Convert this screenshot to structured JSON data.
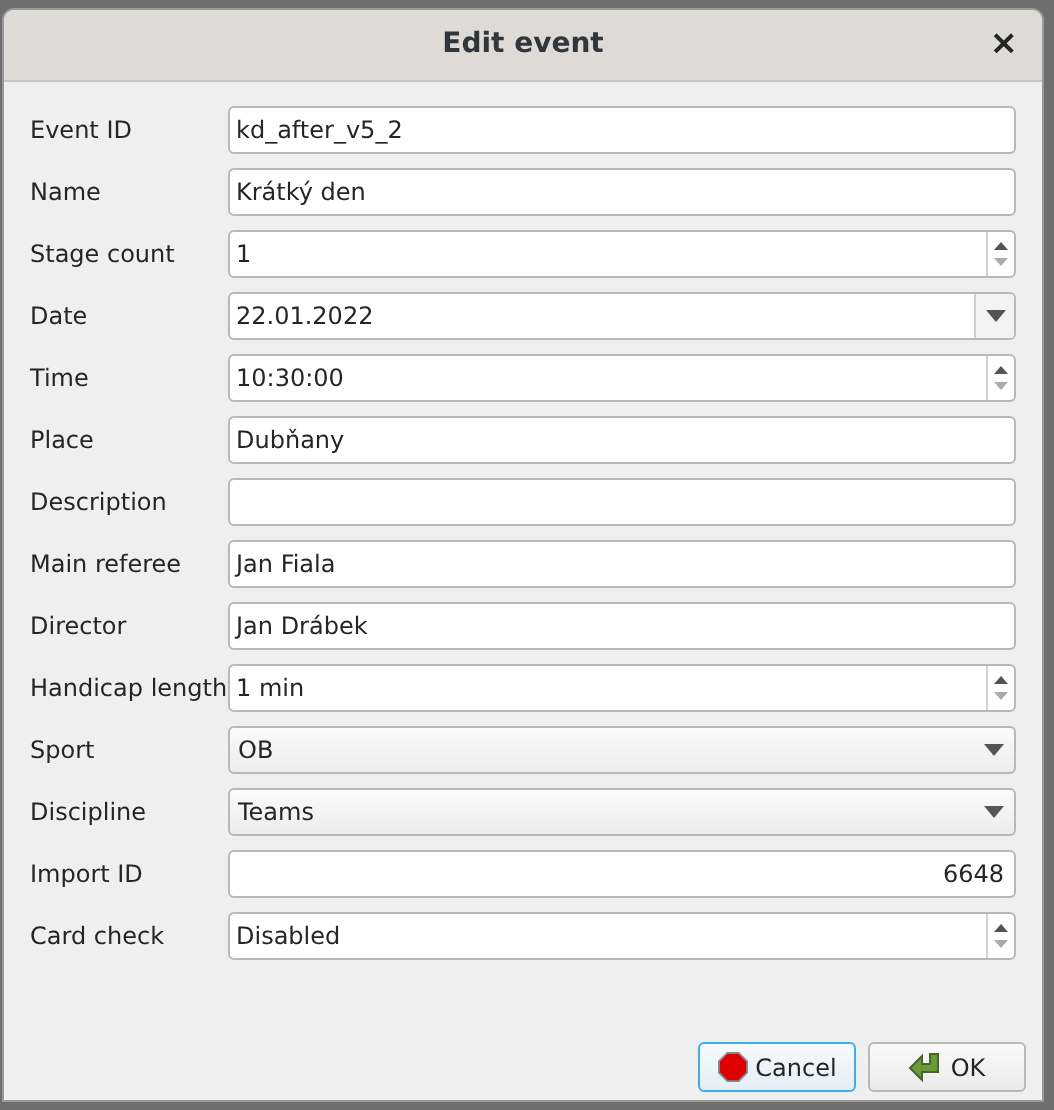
{
  "window": {
    "title": "Edit event",
    "close": "×"
  },
  "fields": [
    {
      "label": "Event ID",
      "kind": "text",
      "value": "kd_after_v5_2"
    },
    {
      "label": "Name",
      "kind": "text",
      "value": "Krátký den"
    },
    {
      "label": "Stage count",
      "kind": "spin",
      "value": "1"
    },
    {
      "label": "Date",
      "kind": "date",
      "value": "22.01.2022"
    },
    {
      "label": "Time",
      "kind": "spin",
      "value": "10:30:00"
    },
    {
      "label": "Place",
      "kind": "text",
      "value": "Dubňany"
    },
    {
      "label": "Description",
      "kind": "text"
    },
    {
      "label": "Main referee",
      "kind": "text",
      "value": "Jan Fiala"
    },
    {
      "label": "Director",
      "kind": "text",
      "value": "Jan Drábek"
    },
    {
      "label": "Handicap length",
      "kind": "spin",
      "value": "1 min"
    },
    {
      "label": "Sport",
      "kind": "combo",
      "value": "OB"
    },
    {
      "label": "Discipline",
      "kind": "combo",
      "value": "Teams"
    },
    {
      "label": "Import ID",
      "kind": "number",
      "value": "6648"
    },
    {
      "label": "Card check",
      "kind": "spin",
      "value": "Disabled"
    }
  ],
  "buttons": [
    {
      "label": "Cancel",
      "kind": "cancel",
      "focused": true
    },
    {
      "label": "OK",
      "kind": "ok",
      "focused": false
    }
  ]
}
